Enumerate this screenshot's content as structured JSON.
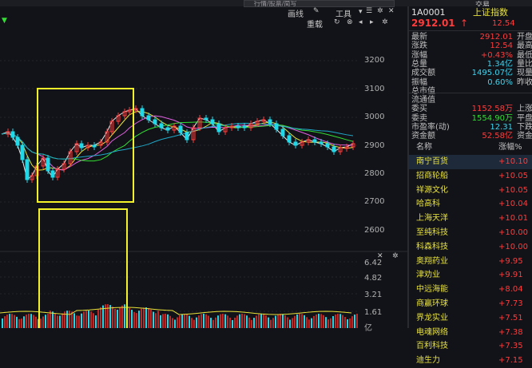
{
  "topbar": {
    "search_text": "行情/股票/简写",
    "right_label": "交易"
  },
  "toolbar": {
    "draw_label": "画线",
    "tools_label": "工具",
    "reload_label": "重载"
  },
  "price_axis": [
    "3200",
    "3100",
    "3000",
    "2900",
    "2800",
    "2700",
    "2600"
  ],
  "volume_axis": [
    "6.42",
    "4.82",
    "3.21",
    "1.61",
    "亿"
  ],
  "index_header": {
    "code": "1A0001",
    "name": "上证指数",
    "price": "2912.01",
    "change": "12.54",
    "arrow": "↑"
  },
  "quote_rows": [
    {
      "label": "最新",
      "value": "2912.01",
      "color": "red",
      "label2": "开盘"
    },
    {
      "label": "涨跌",
      "value": "12.54",
      "color": "red",
      "label2": "最高"
    },
    {
      "label": "涨幅",
      "value": "+0.43%",
      "color": "red",
      "label2": "最低"
    },
    {
      "label": "总量",
      "value": "1.34亿",
      "color": "cyan",
      "label2": "量比"
    },
    {
      "label": "成交额",
      "value": "1495.07亿",
      "color": "cyan",
      "label2": "现量"
    },
    {
      "label": "振幅",
      "value": "0.60%",
      "color": "cyan",
      "label2": "昨收"
    },
    {
      "label": "总市值",
      "value": "",
      "color": "white",
      "label2": ""
    },
    {
      "label": "流通值",
      "value": "",
      "color": "white",
      "label2": ""
    },
    {
      "label": "委买",
      "value": "1152.58万",
      "color": "red",
      "label2": "上涨"
    },
    {
      "label": "委卖",
      "value": "1554.90万",
      "color": "green",
      "label2": "平盘"
    },
    {
      "label": "市盈率(动)",
      "value": "12.31",
      "color": "cyan",
      "label2": "下跌"
    },
    {
      "label": "资金额",
      "value": "52.58亿",
      "color": "red",
      "label2": "资金"
    }
  ],
  "list_header": {
    "name": "名称",
    "pct": "涨幅%"
  },
  "stock_list": [
    {
      "name": "南宁百货",
      "pct": "+10.10"
    },
    {
      "name": "招商轮船",
      "pct": "+10.05"
    },
    {
      "name": "祥源文化",
      "pct": "+10.05"
    },
    {
      "name": "哈高科",
      "pct": "+10.04"
    },
    {
      "name": "上海天洋",
      "pct": "+10.01"
    },
    {
      "name": "至纯科技",
      "pct": "+10.00"
    },
    {
      "name": "科森科技",
      "pct": "+10.00"
    },
    {
      "name": "奥翔药业",
      "pct": "+9.95"
    },
    {
      "name": "津劝业",
      "pct": "+9.91"
    },
    {
      "name": "中远海能",
      "pct": "+8.04"
    },
    {
      "name": "商赢环球",
      "pct": "+7.73"
    },
    {
      "name": "界龙实业",
      "pct": "+7.51"
    },
    {
      "name": "电魂网络",
      "pct": "+7.38"
    },
    {
      "name": "百利科技",
      "pct": "+7.35"
    },
    {
      "name": "迪生力",
      "pct": "+7.15"
    }
  ],
  "colors": {
    "up": "#ff3b3b",
    "down": "#20d8e8",
    "highlight_box": "#f3f12a"
  }
}
